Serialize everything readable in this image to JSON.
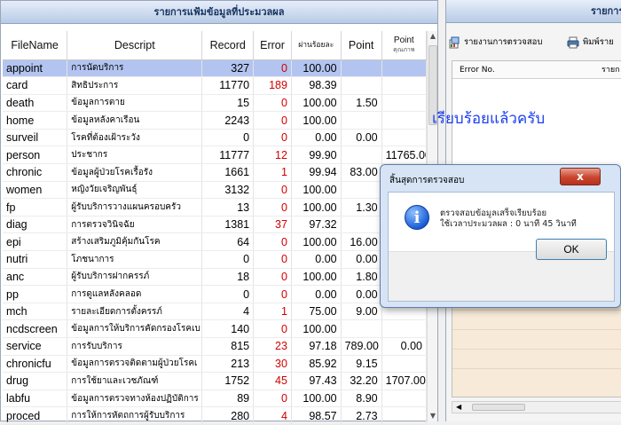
{
  "left_panel": {
    "title": "รายการแฟ้มข้อมูลที่ประมวลผล",
    "columns": [
      "FileName",
      "Descript",
      "Record",
      "Error",
      "ผ่านร้อยละ",
      "Point",
      "Point",
      "คุณภาพ"
    ],
    "rows": [
      {
        "file": "appoint",
        "desc": "การนัดบริการ",
        "record": "327",
        "error": "0",
        "pass": "100.00",
        "point": "",
        "quality": ""
      },
      {
        "file": "card",
        "desc": "สิทธิประการ",
        "record": "11770",
        "error": "189",
        "pass": "98.39",
        "point": "",
        "quality": ""
      },
      {
        "file": "death",
        "desc": "ข้อมูลการตาย",
        "record": "15",
        "error": "0",
        "pass": "100.00",
        "point": "1.50",
        "quality": ""
      },
      {
        "file": "home",
        "desc": "ข้อมูลหลังคาเรือน",
        "record": "2243",
        "error": "0",
        "pass": "100.00",
        "point": "",
        "quality": ""
      },
      {
        "file": "surveil",
        "desc": "โรคที่ต้องเฝ้าระวัง",
        "record": "0",
        "error": "0",
        "pass": "0.00",
        "point": "0.00",
        "quality": ""
      },
      {
        "file": "person",
        "desc": "ประชากร",
        "record": "11777",
        "error": "12",
        "pass": "99.90",
        "point": "",
        "quality": "11765.00"
      },
      {
        "file": "chronic",
        "desc": "ข้อมูลผู้ป่วยโรคเรื้อรัง",
        "record": "1661",
        "error": "1",
        "pass": "99.94",
        "point": "83.00",
        "quality": ""
      },
      {
        "file": "women",
        "desc": "หญิงวัยเจริญพันธุ์",
        "record": "3132",
        "error": "0",
        "pass": "100.00",
        "point": "",
        "quality": ""
      },
      {
        "file": "fp",
        "desc": "ผู้รับบริการวางแผนครอบครัว",
        "record": "13",
        "error": "0",
        "pass": "100.00",
        "point": "1.30",
        "quality": ""
      },
      {
        "file": "diag",
        "desc": "การตรวจวินิจฉัย",
        "record": "1381",
        "error": "37",
        "pass": "97.32",
        "point": "",
        "quality": ""
      },
      {
        "file": "epi",
        "desc": "สร้างเสริมภูมิคุ้มกันโรค",
        "record": "64",
        "error": "0",
        "pass": "100.00",
        "point": "16.00",
        "quality": ""
      },
      {
        "file": "nutri",
        "desc": "โภชนาการ",
        "record": "0",
        "error": "0",
        "pass": "0.00",
        "point": "0.00",
        "quality": ""
      },
      {
        "file": "anc",
        "desc": "ผู้รับบริการฝากครรภ์",
        "record": "18",
        "error": "0",
        "pass": "100.00",
        "point": "1.80",
        "quality": ""
      },
      {
        "file": "pp",
        "desc": "การดูแลหลังคลอด",
        "record": "0",
        "error": "0",
        "pass": "0.00",
        "point": "0.00",
        "quality": ""
      },
      {
        "file": "mch",
        "desc": "รายละเอียดการตั้งครรภ์",
        "record": "4",
        "error": "1",
        "pass": "75.00",
        "point": "9.00",
        "quality": ""
      },
      {
        "file": "ncdscreen",
        "desc": "ข้อมูลการให้บริการคัดกรองโรคเบ",
        "record": "140",
        "error": "0",
        "pass": "100.00",
        "point": "",
        "quality": ""
      },
      {
        "file": "service",
        "desc": "การรับบริการ",
        "record": "815",
        "error": "23",
        "pass": "97.18",
        "point": "789.00",
        "quality": "0.00"
      },
      {
        "file": "chronicfu",
        "desc": "ข้อมูลการตรวจติดตามผู้ป่วยโรคเ",
        "record": "213",
        "error": "30",
        "pass": "85.92",
        "point": "9.15",
        "quality": ""
      },
      {
        "file": "drug",
        "desc": "การใช้ยาและเวชภัณฑ์",
        "record": "1752",
        "error": "45",
        "pass": "97.43",
        "point": "32.20",
        "quality": "1707.00"
      },
      {
        "file": "labfu",
        "desc": "ข้อมูลการตรวจทางห้องปฏิบัติการ",
        "record": "89",
        "error": "0",
        "pass": "100.00",
        "point": "8.90",
        "quality": ""
      },
      {
        "file": "proced",
        "desc": "การให้การหัตถการผู้รับบริการ",
        "record": "280",
        "error": "4",
        "pass": "98.57",
        "point": "2.73",
        "quality": ""
      }
    ]
  },
  "right_panel": {
    "title": "รายการ",
    "toolbar": {
      "report_label": "รายงานการตรวจสอบ",
      "print_label": "พิมพ์ราย"
    },
    "list_headers": {
      "error_no": "Error No.",
      "detail": "รายก"
    },
    "done_message": "เรียบร้อยแล้วครับ"
  },
  "dialog": {
    "title": "สิ้นสุดการตรวจสอบ",
    "close_label": "x",
    "line1": "ตรวจสอบข้อมูลเสร็จเรียบร้อย",
    "line2": "ใช้เวลาประมวลผล : 0 นาที 45 วินาที",
    "ok_label": "OK"
  },
  "colors": {
    "selected_row": "#b3c4f0",
    "error_text": "#d00000",
    "message_blue": "#1a3ef0",
    "close_red": "#c9452e"
  },
  "icons": [
    "report-icon",
    "print-icon",
    "info-icon",
    "scroll-up-icon",
    "scroll-down-icon",
    "scroll-left-icon"
  ]
}
